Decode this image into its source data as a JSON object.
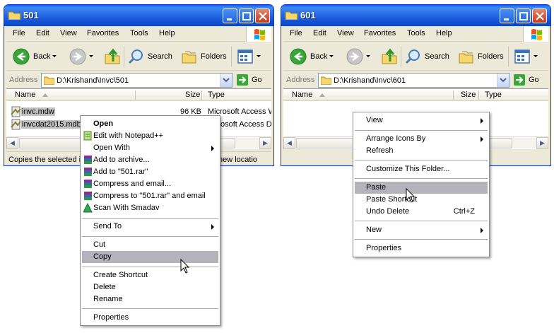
{
  "colors": {
    "title_gradient": "#2a6fe8",
    "menu_highlight": "#b4b3bb",
    "window_frame": "#0831d9"
  },
  "left_window": {
    "title": "501",
    "menu": [
      "File",
      "Edit",
      "View",
      "Favorites",
      "Tools",
      "Help"
    ],
    "toolbar": {
      "back": "Back",
      "search": "Search",
      "folders": "Folders"
    },
    "address": {
      "label": "Address",
      "path": "D:\\Krishand\\Invc\\501",
      "go": "Go"
    },
    "columns": {
      "name": "Name",
      "size": "Size",
      "type": "Type"
    },
    "files": [
      {
        "name": "invc.mdw",
        "size": "96 KB",
        "type": "Microsoft Access W"
      },
      {
        "name": "invcdat2015.mdb",
        "size": "",
        "type": "osoft Access Da"
      }
    ],
    "status": {
      "left": "Copies the selected it",
      "right": "new locatio"
    },
    "context_menu": {
      "open": "Open",
      "edit_notepad": "Edit with Notepad++",
      "open_with": "Open With",
      "add_archive": "Add to archive...",
      "add_rar": "Add to \"501.rar\"",
      "compress_email": "Compress and email...",
      "compress_rar_email": "Compress to \"501.rar\" and email",
      "scan": "Scan With Smadav",
      "send_to": "Send To",
      "cut": "Cut",
      "copy": "Copy",
      "create_shortcut": "Create Shortcut",
      "delete": "Delete",
      "rename": "Rename",
      "properties": "Properties"
    }
  },
  "right_window": {
    "title": "601",
    "menu": [
      "File",
      "Edit",
      "View",
      "Favorites",
      "Tools",
      "Help"
    ],
    "toolbar": {
      "back": "Back",
      "search": "Search",
      "folders": "Folders"
    },
    "address": {
      "label": "Address",
      "path": "D:\\Krishand\\Invc\\601",
      "go": "Go"
    },
    "columns": {
      "name": "Name",
      "size": "Size",
      "type": "Type"
    },
    "context_menu": {
      "view": "View",
      "arrange": "Arrange Icons By",
      "refresh": "Refresh",
      "customize": "Customize This Folder...",
      "paste": "Paste",
      "paste_shortcut": "Paste Shortcut",
      "undo_delete": "Undo Delete",
      "undo_shortcut": "Ctrl+Z",
      "new": "New",
      "properties": "Properties"
    }
  }
}
